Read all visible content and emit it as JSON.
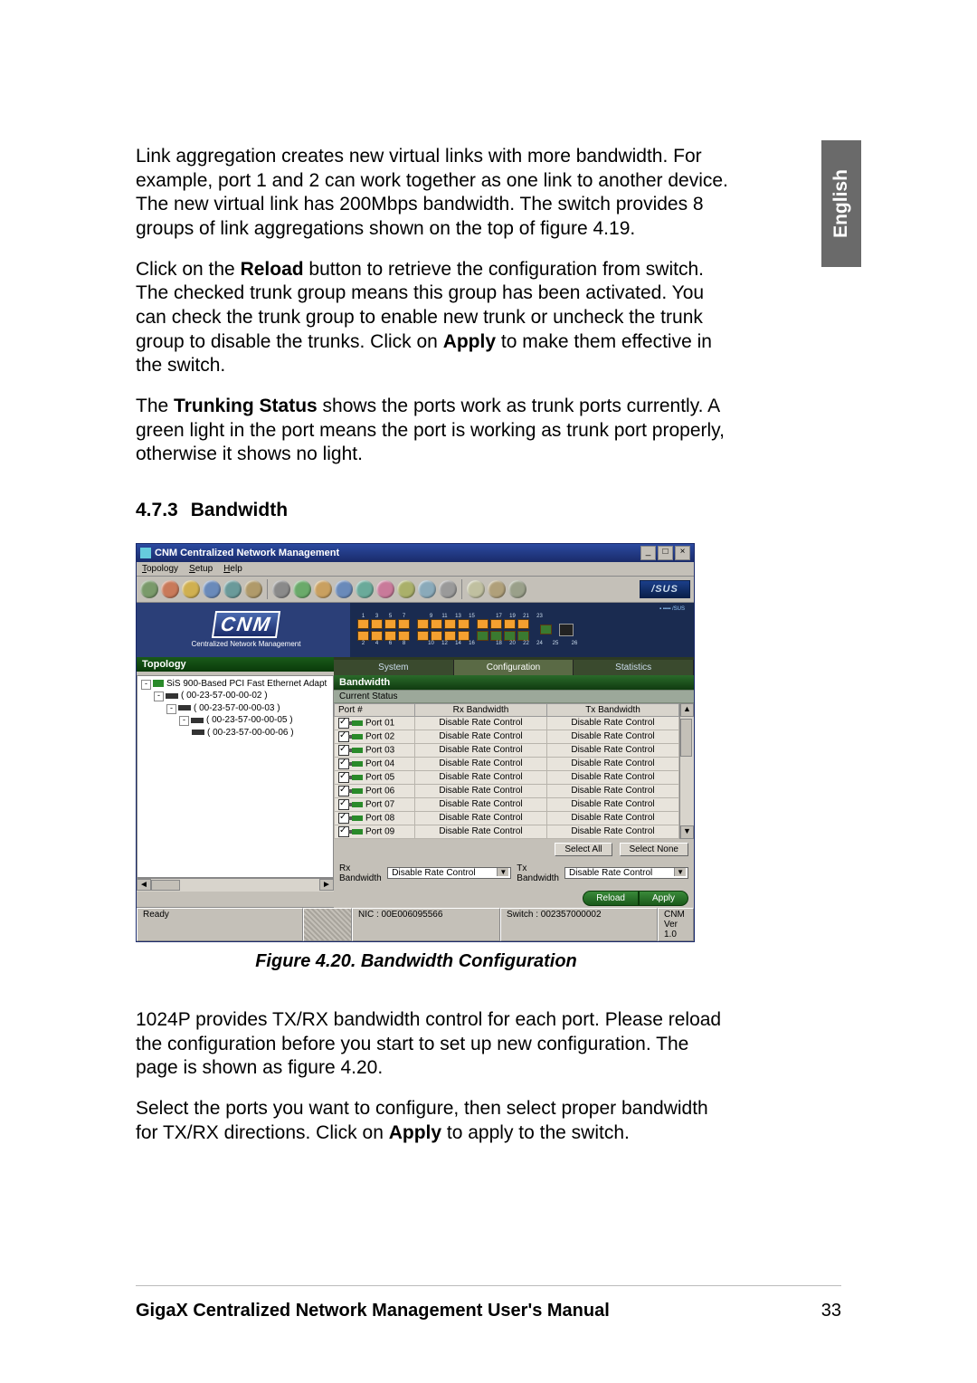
{
  "sideTab": "English",
  "para1_a": "Link aggregation creates new virtual links with more bandwidth. For example, port 1 and 2 can work together as one link to another device. The new virtual link has 200Mbps bandwidth. The switch provides 8 groups of link aggregations shown on the top of figure 4.19.",
  "para2_pre": "Click on the ",
  "para2_b1": "Reload",
  "para2_mid": " button to retrieve the configuration from switch. The checked trunk group means this group has been activated. You can check the trunk group to enable new trunk or uncheck the trunk group to disable the trunks. Click on ",
  "para2_b2": "Apply",
  "para2_post": " to make them effective in the switch.",
  "para3_pre": "The ",
  "para3_b": "Trunking Status",
  "para3_post": " shows the ports work as trunk ports currently. A green light in the port means the port is working as trunk port properly, otherwise it shows no light.",
  "h3_num": "4.7.3",
  "h3_txt": "Bandwidth",
  "figcap": "Figure 4.20. Bandwidth Configuration",
  "para4": "1024P provides TX/RX bandwidth control for each port. Please reload the configuration before you start to set up new configuration. The page is shown as figure 4.20.",
  "para5_pre": "Select the ports you want to configure, then select proper bandwidth for TX/RX directions. Click on ",
  "para5_b": "Apply",
  "para5_post": " to apply to the switch.",
  "footer_title": "GigaX Centralized Network Management User's Manual",
  "footer_page": "33",
  "app": {
    "title": "CNM Centralized Network Management",
    "menus": [
      "Topology",
      "Setup",
      "Help"
    ],
    "brand": "/SUS",
    "logo": "CNM",
    "logo_sub": "Centralized Network Management",
    "topPortsRow1": [
      "1",
      "3",
      "5",
      "7",
      "9",
      "11",
      "13",
      "15",
      "17",
      "19",
      "21",
      "23"
    ],
    "topPortsRow2": [
      "2",
      "4",
      "6",
      "8",
      "10",
      "12",
      "14",
      "16",
      "18",
      "20",
      "22",
      "24",
      "25",
      "26"
    ],
    "topologyHeader": "Topology",
    "tabs": {
      "system": "System",
      "config": "Configuration",
      "stats": "Statistics"
    },
    "tree": {
      "root": "SiS 900-Based PCI Fast Ethernet Adapt",
      "n1": "( 00-23-57-00-00-02 )",
      "n2": "( 00-23-57-00-00-03 )",
      "n3": "( 00-23-57-00-00-05 )",
      "n4": "( 00-23-57-00-00-06 )"
    },
    "sectionTitle": "Bandwidth",
    "currentStatus": "Current Status",
    "cols": {
      "port": "Port #",
      "rx": "Rx Bandwidth",
      "tx": "Tx Bandwidth"
    },
    "rows": [
      {
        "p": "Port 01",
        "rx": "Disable Rate Control",
        "tx": "Disable Rate Control"
      },
      {
        "p": "Port 02",
        "rx": "Disable Rate Control",
        "tx": "Disable Rate Control"
      },
      {
        "p": "Port 03",
        "rx": "Disable Rate Control",
        "tx": "Disable Rate Control"
      },
      {
        "p": "Port 04",
        "rx": "Disable Rate Control",
        "tx": "Disable Rate Control"
      },
      {
        "p": "Port 05",
        "rx": "Disable Rate Control",
        "tx": "Disable Rate Control"
      },
      {
        "p": "Port 06",
        "rx": "Disable Rate Control",
        "tx": "Disable Rate Control"
      },
      {
        "p": "Port 07",
        "rx": "Disable Rate Control",
        "tx": "Disable Rate Control"
      },
      {
        "p": "Port 08",
        "rx": "Disable Rate Control",
        "tx": "Disable Rate Control"
      },
      {
        "p": "Port 09",
        "rx": "Disable Rate Control",
        "tx": "Disable Rate Control"
      }
    ],
    "btn_selectAll": "Select All",
    "btn_selectNone": "Select None",
    "lbl_rx": "Rx Bandwidth",
    "dd_rx": "Disable Rate Control",
    "lbl_tx": "Tx Bandwidth",
    "dd_tx": "Disable Rate Control",
    "btn_reload": "Reload",
    "btn_apply": "Apply",
    "status": {
      "ready": "Ready",
      "nic": "NIC : 00E006095566",
      "switch": "Switch : 002357000002",
      "ver": "CNM Ver 1.0"
    }
  }
}
